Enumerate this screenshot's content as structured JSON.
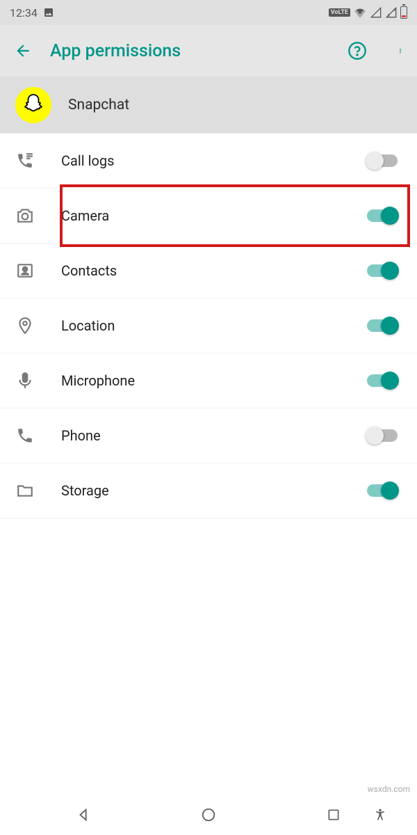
{
  "status": {
    "time": "12:34",
    "volte": "VoLTE"
  },
  "header": {
    "title": "App permissions"
  },
  "app": {
    "name": "Snapchat"
  },
  "permissions": [
    {
      "id": "call-logs",
      "label": "Call logs",
      "enabled": false,
      "highlighted": false
    },
    {
      "id": "camera",
      "label": "Camera",
      "enabled": true,
      "highlighted": true
    },
    {
      "id": "contacts",
      "label": "Contacts",
      "enabled": true,
      "highlighted": false
    },
    {
      "id": "location",
      "label": "Location",
      "enabled": true,
      "highlighted": false
    },
    {
      "id": "microphone",
      "label": "Microphone",
      "enabled": true,
      "highlighted": false
    },
    {
      "id": "phone",
      "label": "Phone",
      "enabled": false,
      "highlighted": false
    },
    {
      "id": "storage",
      "label": "Storage",
      "enabled": true,
      "highlighted": false
    }
  ],
  "colors": {
    "accent": "#009688",
    "highlight": "#d11a1a",
    "snapchat": "#fffc00"
  },
  "watermark": "wsxdn.com"
}
